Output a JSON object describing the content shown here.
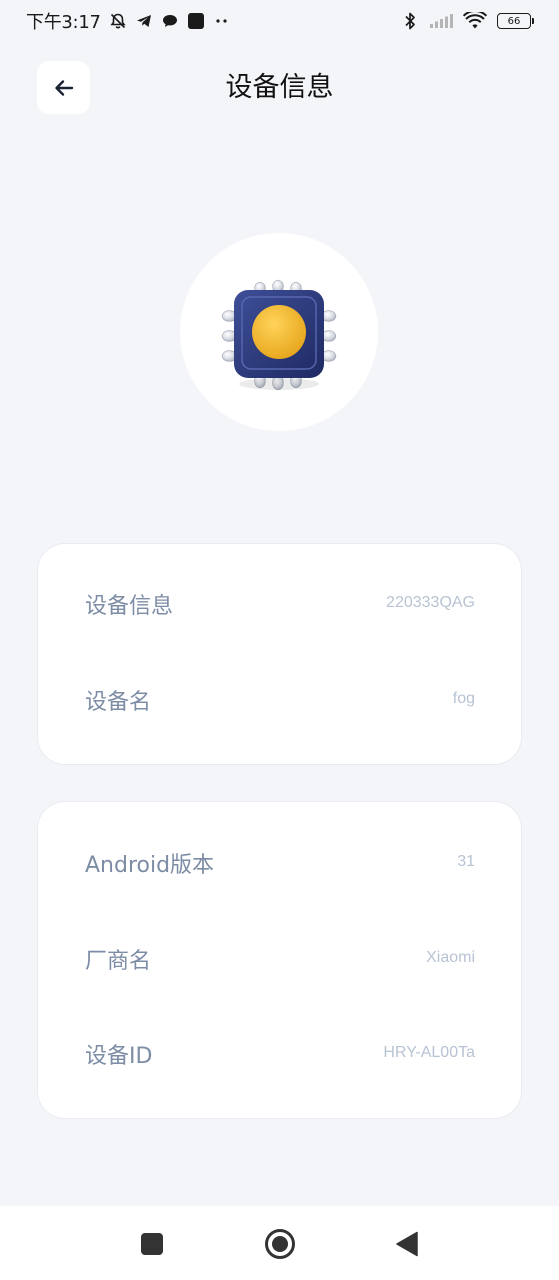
{
  "status_bar": {
    "time": "下午3:17",
    "left_icons": [
      "bell-off-icon",
      "telegram-icon",
      "chat-bubble-icon",
      "square-app-icon",
      "more-dots-icon"
    ],
    "right_icons": [
      "bluetooth-icon",
      "signal-icon",
      "wifi-icon"
    ],
    "battery": "66"
  },
  "header": {
    "title": "设备信息",
    "back_icon": "arrow-left-icon"
  },
  "hero": {
    "icon": "chip-icon",
    "colors": {
      "chip": "#2b3a7a",
      "core": "#f2b52a"
    }
  },
  "card1": {
    "rows": [
      {
        "label": "设备信息",
        "value": "220333QAG"
      },
      {
        "label": "设备名",
        "value": "fog"
      }
    ]
  },
  "card2": {
    "rows": [
      {
        "label": "Android版本",
        "value": "31"
      },
      {
        "label": "厂商名",
        "value": "Xiaomi"
      },
      {
        "label": "设备ID",
        "value": "HRY-AL00Ta"
      }
    ]
  },
  "nav_bar": {
    "buttons": [
      "recents-square-icon",
      "home-circle-icon",
      "back-triangle-icon"
    ]
  }
}
